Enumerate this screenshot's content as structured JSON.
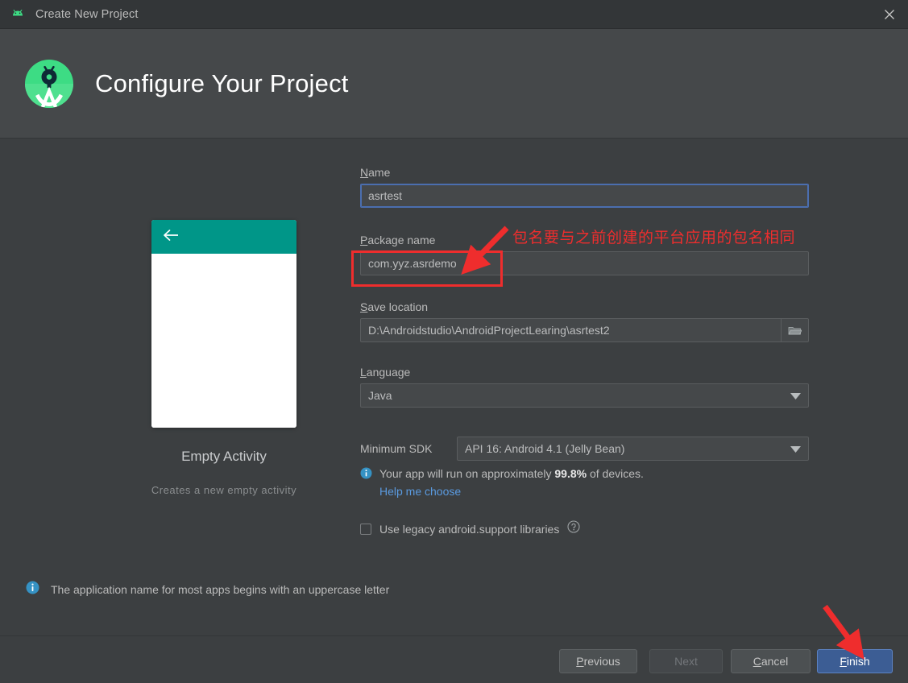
{
  "window": {
    "title": "Create New Project",
    "app_icon": "android-head-icon",
    "close_icon": "close-icon"
  },
  "header": {
    "title": "Configure Your Project",
    "logo_icon": "android-studio-logo-icon"
  },
  "preview": {
    "name": "Empty Activity",
    "description": "Creates a new empty activity",
    "appbar_color": "#009688",
    "back_icon": "back-arrow-icon"
  },
  "form": {
    "name": {
      "label_mnemonic": "N",
      "label_rest": "ame",
      "value": "asrtest",
      "focused": true
    },
    "package_name": {
      "label_mnemonic": "P",
      "label_rest": "ackage name",
      "value": "com.yyz.asrdemo"
    },
    "save_location": {
      "label_mnemonic": "S",
      "label_rest": "ave location",
      "value": "D:\\Androidstudio\\AndroidProjectLearing\\asrtest2",
      "browse_icon": "folder-icon"
    },
    "language": {
      "label_mnemonic": "L",
      "label_rest": "anguage",
      "value": "Java",
      "dropdown_icon": "chevron-down-icon"
    },
    "minimum_sdk": {
      "label": "Minimum SDK",
      "value": "API 16: Android 4.1 (Jelly Bean)",
      "dropdown_icon": "chevron-down-icon"
    },
    "sdk_note": {
      "icon": "info-icon",
      "prefix": "Your app will run on approximately ",
      "percent": "99.8%",
      "suffix": " of devices.",
      "help_link": "Help me choose"
    },
    "legacy_libraries": {
      "label": "Use legacy android.support libraries",
      "checked": false,
      "help_icon": "question-circle-icon"
    }
  },
  "footer_info": {
    "icon": "info-icon",
    "text": "The application name for most apps begins with an uppercase letter"
  },
  "buttons": {
    "previous": {
      "mnemonic": "P",
      "rest": "revious"
    },
    "next": {
      "label": "Next",
      "disabled": true
    },
    "cancel": {
      "mnemonic": "C",
      "rest": "ancel"
    },
    "finish": {
      "mnemonic": "F",
      "rest": "inish",
      "primary": true
    }
  },
  "annotations": {
    "package_note": "包名要与之前创建的平台应用的包名相同",
    "color": "#ef2d2d",
    "arrow_to_package": true,
    "arrow_to_finish": true
  },
  "colors": {
    "window_bg": "#3c3f41",
    "titlebar_bg": "#333638",
    "header_bg": "#45484a",
    "accent_blue": "#5a9adf",
    "finish_blue": "#3c5d94",
    "annotation_red": "#ef2d2d",
    "teal": "#009688"
  }
}
